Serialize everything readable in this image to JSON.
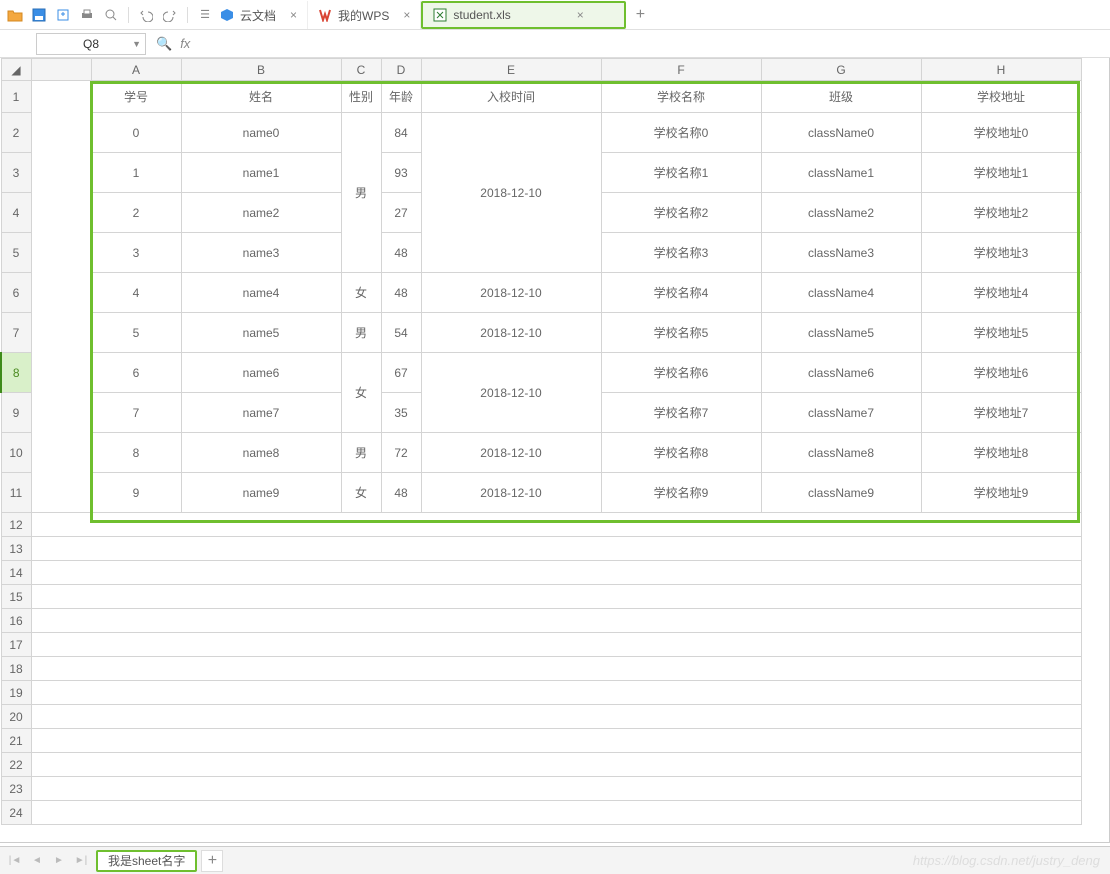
{
  "toolbar_icons": [
    "folder-open-icon",
    "save-icon",
    "export-icon",
    "print-icon",
    "print-preview-icon",
    "undo-icon",
    "redo-icon"
  ],
  "tabs": [
    {
      "icon": "cube-icon",
      "label": "云文档",
      "active": false,
      "icon_color": "#3a8ee6"
    },
    {
      "icon": "wps-icon",
      "label": "我的WPS",
      "active": false,
      "icon_color": "#d94433"
    },
    {
      "icon": "xls-icon",
      "label": "student.xls",
      "active": true,
      "icon_color": "#2e7d32"
    }
  ],
  "name_box": "Q8",
  "fx_label": "fx",
  "columns": [
    "A",
    "B",
    "C",
    "D",
    "E",
    "F",
    "G",
    "H"
  ],
  "row_count": 24,
  "selected_row": 8,
  "headers": [
    "学号",
    "姓名",
    "性别",
    "年龄",
    "入校时间",
    "学校名称",
    "班级",
    "学校地址"
  ],
  "data": {
    "rows": [
      {
        "id": "0",
        "name": "name0",
        "age": "84",
        "school": "学校名称0",
        "class": "className0",
        "addr": "学校地址0"
      },
      {
        "id": "1",
        "name": "name1",
        "age": "93",
        "school": "学校名称1",
        "class": "className1",
        "addr": "学校地址1"
      },
      {
        "id": "2",
        "name": "name2",
        "age": "27",
        "school": "学校名称2",
        "class": "className2",
        "addr": "学校地址2"
      },
      {
        "id": "3",
        "name": "name3",
        "age": "48",
        "school": "学校名称3",
        "class": "className3",
        "addr": "学校地址3"
      },
      {
        "id": "4",
        "name": "name4",
        "age": "48",
        "school": "学校名称4",
        "class": "className4",
        "addr": "学校地址4",
        "gender": "女",
        "date": "2018-12-10"
      },
      {
        "id": "5",
        "name": "name5",
        "age": "54",
        "school": "学校名称5",
        "class": "className5",
        "addr": "学校地址5",
        "gender": "男",
        "date": "2018-12-10"
      },
      {
        "id": "6",
        "name": "name6",
        "age": "67",
        "school": "学校名称6",
        "class": "className6",
        "addr": "学校地址6"
      },
      {
        "id": "7",
        "name": "name7",
        "age": "35",
        "school": "学校名称7",
        "class": "className7",
        "addr": "学校地址7"
      },
      {
        "id": "8",
        "name": "name8",
        "age": "72",
        "school": "学校名称8",
        "class": "className8",
        "addr": "学校地址8",
        "gender": "男",
        "date": "2018-12-10"
      },
      {
        "id": "9",
        "name": "name9",
        "age": "48",
        "school": "学校名称9",
        "class": "className9",
        "addr": "学校地址9",
        "gender": "女",
        "date": "2018-12-10"
      }
    ],
    "merge_gender_0_3": "男",
    "merge_date_0_3": "2018-12-10",
    "merge_gender_6_7": "女",
    "merge_date_6_7": "2018-12-10"
  },
  "sheet_tab": "我是sheet名字",
  "watermark": "https://blog.csdn.net/justry_deng"
}
